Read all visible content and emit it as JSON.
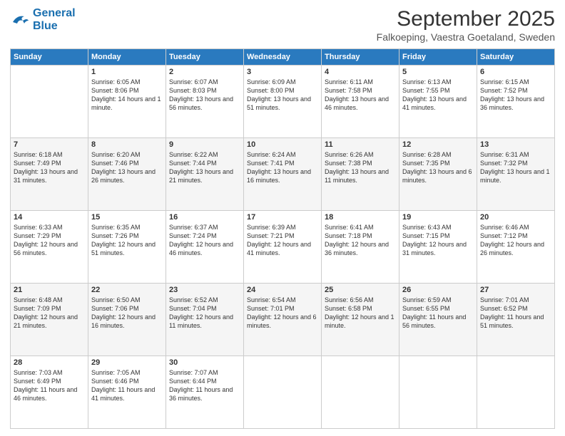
{
  "logo": {
    "line1": "General",
    "line2": "Blue"
  },
  "title": "September 2025",
  "subtitle": "Falkoeping, Vaestra Goetaland, Sweden",
  "days_header": [
    "Sunday",
    "Monday",
    "Tuesday",
    "Wednesday",
    "Thursday",
    "Friday",
    "Saturday"
  ],
  "weeks": [
    [
      {
        "num": "",
        "sunrise": "",
        "sunset": "",
        "daylight": ""
      },
      {
        "num": "1",
        "sunrise": "Sunrise: 6:05 AM",
        "sunset": "Sunset: 8:06 PM",
        "daylight": "Daylight: 14 hours and 1 minute."
      },
      {
        "num": "2",
        "sunrise": "Sunrise: 6:07 AM",
        "sunset": "Sunset: 8:03 PM",
        "daylight": "Daylight: 13 hours and 56 minutes."
      },
      {
        "num": "3",
        "sunrise": "Sunrise: 6:09 AM",
        "sunset": "Sunset: 8:00 PM",
        "daylight": "Daylight: 13 hours and 51 minutes."
      },
      {
        "num": "4",
        "sunrise": "Sunrise: 6:11 AM",
        "sunset": "Sunset: 7:58 PM",
        "daylight": "Daylight: 13 hours and 46 minutes."
      },
      {
        "num": "5",
        "sunrise": "Sunrise: 6:13 AM",
        "sunset": "Sunset: 7:55 PM",
        "daylight": "Daylight: 13 hours and 41 minutes."
      },
      {
        "num": "6",
        "sunrise": "Sunrise: 6:15 AM",
        "sunset": "Sunset: 7:52 PM",
        "daylight": "Daylight: 13 hours and 36 minutes."
      }
    ],
    [
      {
        "num": "7",
        "sunrise": "Sunrise: 6:18 AM",
        "sunset": "Sunset: 7:49 PM",
        "daylight": "Daylight: 13 hours and 31 minutes."
      },
      {
        "num": "8",
        "sunrise": "Sunrise: 6:20 AM",
        "sunset": "Sunset: 7:46 PM",
        "daylight": "Daylight: 13 hours and 26 minutes."
      },
      {
        "num": "9",
        "sunrise": "Sunrise: 6:22 AM",
        "sunset": "Sunset: 7:44 PM",
        "daylight": "Daylight: 13 hours and 21 minutes."
      },
      {
        "num": "10",
        "sunrise": "Sunrise: 6:24 AM",
        "sunset": "Sunset: 7:41 PM",
        "daylight": "Daylight: 13 hours and 16 minutes."
      },
      {
        "num": "11",
        "sunrise": "Sunrise: 6:26 AM",
        "sunset": "Sunset: 7:38 PM",
        "daylight": "Daylight: 13 hours and 11 minutes."
      },
      {
        "num": "12",
        "sunrise": "Sunrise: 6:28 AM",
        "sunset": "Sunset: 7:35 PM",
        "daylight": "Daylight: 13 hours and 6 minutes."
      },
      {
        "num": "13",
        "sunrise": "Sunrise: 6:31 AM",
        "sunset": "Sunset: 7:32 PM",
        "daylight": "Daylight: 13 hours and 1 minute."
      }
    ],
    [
      {
        "num": "14",
        "sunrise": "Sunrise: 6:33 AM",
        "sunset": "Sunset: 7:29 PM",
        "daylight": "Daylight: 12 hours and 56 minutes."
      },
      {
        "num": "15",
        "sunrise": "Sunrise: 6:35 AM",
        "sunset": "Sunset: 7:26 PM",
        "daylight": "Daylight: 12 hours and 51 minutes."
      },
      {
        "num": "16",
        "sunrise": "Sunrise: 6:37 AM",
        "sunset": "Sunset: 7:24 PM",
        "daylight": "Daylight: 12 hours and 46 minutes."
      },
      {
        "num": "17",
        "sunrise": "Sunrise: 6:39 AM",
        "sunset": "Sunset: 7:21 PM",
        "daylight": "Daylight: 12 hours and 41 minutes."
      },
      {
        "num": "18",
        "sunrise": "Sunrise: 6:41 AM",
        "sunset": "Sunset: 7:18 PM",
        "daylight": "Daylight: 12 hours and 36 minutes."
      },
      {
        "num": "19",
        "sunrise": "Sunrise: 6:43 AM",
        "sunset": "Sunset: 7:15 PM",
        "daylight": "Daylight: 12 hours and 31 minutes."
      },
      {
        "num": "20",
        "sunrise": "Sunrise: 6:46 AM",
        "sunset": "Sunset: 7:12 PM",
        "daylight": "Daylight: 12 hours and 26 minutes."
      }
    ],
    [
      {
        "num": "21",
        "sunrise": "Sunrise: 6:48 AM",
        "sunset": "Sunset: 7:09 PM",
        "daylight": "Daylight: 12 hours and 21 minutes."
      },
      {
        "num": "22",
        "sunrise": "Sunrise: 6:50 AM",
        "sunset": "Sunset: 7:06 PM",
        "daylight": "Daylight: 12 hours and 16 minutes."
      },
      {
        "num": "23",
        "sunrise": "Sunrise: 6:52 AM",
        "sunset": "Sunset: 7:04 PM",
        "daylight": "Daylight: 12 hours and 11 minutes."
      },
      {
        "num": "24",
        "sunrise": "Sunrise: 6:54 AM",
        "sunset": "Sunset: 7:01 PM",
        "daylight": "Daylight: 12 hours and 6 minutes."
      },
      {
        "num": "25",
        "sunrise": "Sunrise: 6:56 AM",
        "sunset": "Sunset: 6:58 PM",
        "daylight": "Daylight: 12 hours and 1 minute."
      },
      {
        "num": "26",
        "sunrise": "Sunrise: 6:59 AM",
        "sunset": "Sunset: 6:55 PM",
        "daylight": "Daylight: 11 hours and 56 minutes."
      },
      {
        "num": "27",
        "sunrise": "Sunrise: 7:01 AM",
        "sunset": "Sunset: 6:52 PM",
        "daylight": "Daylight: 11 hours and 51 minutes."
      }
    ],
    [
      {
        "num": "28",
        "sunrise": "Sunrise: 7:03 AM",
        "sunset": "Sunset: 6:49 PM",
        "daylight": "Daylight: 11 hours and 46 minutes."
      },
      {
        "num": "29",
        "sunrise": "Sunrise: 7:05 AM",
        "sunset": "Sunset: 6:46 PM",
        "daylight": "Daylight: 11 hours and 41 minutes."
      },
      {
        "num": "30",
        "sunrise": "Sunrise: 7:07 AM",
        "sunset": "Sunset: 6:44 PM",
        "daylight": "Daylight: 11 hours and 36 minutes."
      },
      {
        "num": "",
        "sunrise": "",
        "sunset": "",
        "daylight": ""
      },
      {
        "num": "",
        "sunrise": "",
        "sunset": "",
        "daylight": ""
      },
      {
        "num": "",
        "sunrise": "",
        "sunset": "",
        "daylight": ""
      },
      {
        "num": "",
        "sunrise": "",
        "sunset": "",
        "daylight": ""
      }
    ]
  ]
}
